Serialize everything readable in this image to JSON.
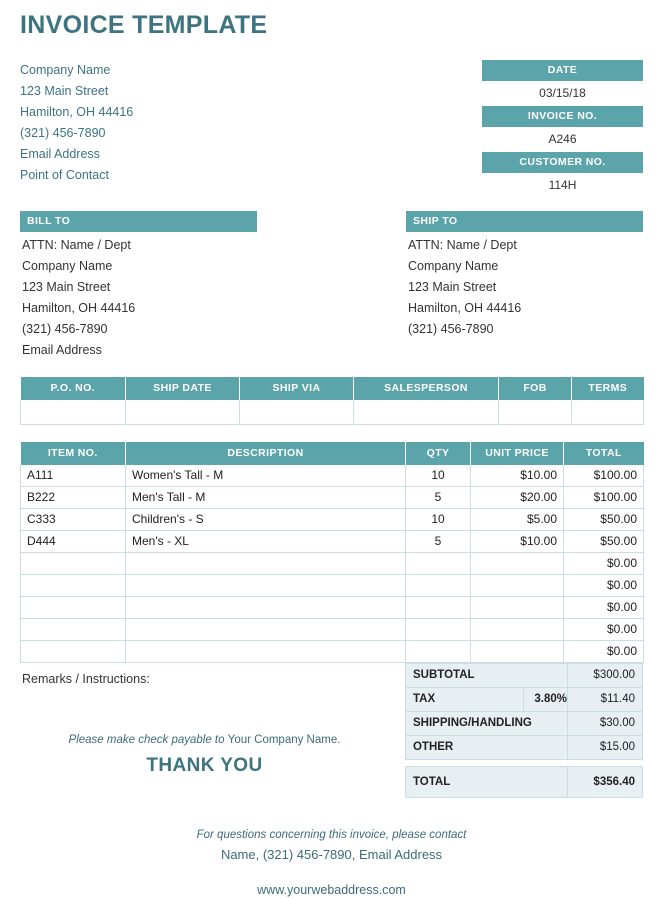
{
  "document": {
    "title": "INVOICE TEMPLATE"
  },
  "colors": {
    "teal_header": "#5aa4aa",
    "title_text": "#3d7480",
    "body_text": "#333333",
    "table_border": "#c9dde2",
    "summary_fill": "#e8eff2"
  },
  "company": {
    "lines": [
      "Company Name",
      "123 Main Street",
      "Hamilton, OH 44416",
      "(321) 456-7890",
      "Email Address",
      "Point of Contact"
    ]
  },
  "meta": {
    "date_label": "DATE",
    "date_value": "03/15/18",
    "invoice_label": "INVOICE NO.",
    "invoice_value": "A246",
    "customer_label": "CUSTOMER NO.",
    "customer_value": "114H"
  },
  "bill_to": {
    "heading": "BILL TO",
    "lines": [
      "ATTN: Name / Dept",
      "Company Name",
      "123 Main Street",
      "Hamilton, OH 44416",
      "(321) 456-7890",
      "Email Address"
    ]
  },
  "ship_to": {
    "heading": "SHIP TO",
    "lines": [
      "ATTN: Name / Dept",
      "Company Name",
      "123 Main Street",
      "Hamilton, OH 44416",
      "(321) 456-7890"
    ]
  },
  "ship_table": {
    "headers": [
      "P.O. NO.",
      "SHIP DATE",
      "SHIP VIA",
      "SALESPERSON",
      "FOB",
      "TERMS"
    ],
    "rows": [
      [
        "",
        "",
        "",
        "",
        "",
        ""
      ]
    ]
  },
  "items_table": {
    "headers": [
      "ITEM NO.",
      "DESCRIPTION",
      "QTY",
      "UNIT PRICE",
      "TOTAL"
    ],
    "rows": [
      {
        "item": "A111",
        "description": "Women's Tall - M",
        "qty": "10",
        "unit_price": "$10.00",
        "total": "$100.00"
      },
      {
        "item": "B222",
        "description": "Men's Tall - M",
        "qty": "5",
        "unit_price": "$20.00",
        "total": "$100.00"
      },
      {
        "item": "C333",
        "description": "Children's - S",
        "qty": "10",
        "unit_price": "$5.00",
        "total": "$50.00"
      },
      {
        "item": "D444",
        "description": "Men's - XL",
        "qty": "5",
        "unit_price": "$10.00",
        "total": "$50.00"
      },
      {
        "item": "",
        "description": "",
        "qty": "",
        "unit_price": "",
        "total": "$0.00"
      },
      {
        "item": "",
        "description": "",
        "qty": "",
        "unit_price": "",
        "total": "$0.00"
      },
      {
        "item": "",
        "description": "",
        "qty": "",
        "unit_price": "",
        "total": "$0.00"
      },
      {
        "item": "",
        "description": "",
        "qty": "",
        "unit_price": "",
        "total": "$0.00"
      },
      {
        "item": "",
        "description": "",
        "qty": "",
        "unit_price": "",
        "total": "$0.00"
      }
    ]
  },
  "remarks": {
    "label": "Remarks / Instructions:",
    "payable_italic": "Please make check payable to ",
    "payable_regular": "Your Company Name.",
    "thank_you": "THANK YOU"
  },
  "summary": {
    "subtotal_label": "SUBTOTAL",
    "subtotal_value": "$300.00",
    "tax_label": "TAX",
    "tax_rate": "3.80%",
    "tax_value": "$11.40",
    "shipping_label": "SHIPPING/HANDLING",
    "shipping_value": "$30.00",
    "other_label": "OTHER",
    "other_value": "$15.00",
    "total_label": "TOTAL",
    "total_value": "$356.40"
  },
  "footer": {
    "line1": "For questions concerning this invoice, please contact",
    "line2": "Name, (321) 456-7890, Email Address",
    "line3": "www.yourwebaddress.com"
  }
}
